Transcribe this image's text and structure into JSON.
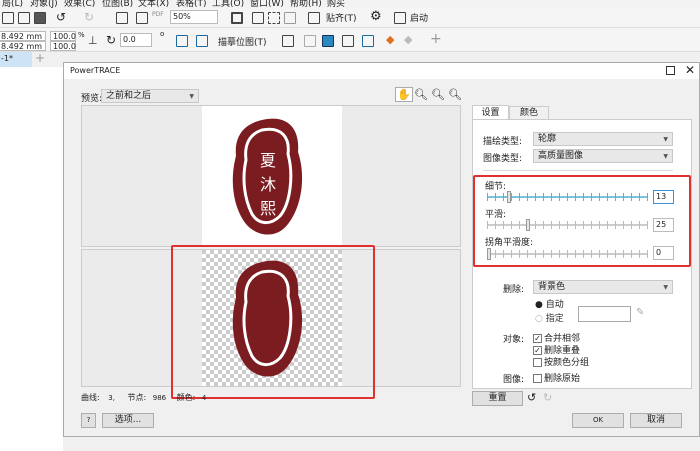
{
  "menu": [
    "局(L)",
    "对象(J)",
    "效果(C)",
    "位图(B)",
    "文本(X)",
    "表格(T)",
    "工具(O)",
    "窗口(W)",
    "帮助(H)",
    "购买"
  ],
  "toolbar": {
    "zoom": "50%",
    "snap": "贴齐(T)",
    "launch": "启动",
    "width": "8.492 mm",
    "height": "8.492 mm",
    "scale_x": "100.0",
    "scale_y": "100.0",
    "pct": "%",
    "angle": "0.0",
    "deg": "o",
    "trace_bitmap": "描摹位图(T)"
  },
  "doc_tab": "-1*",
  "dialog": {
    "title": "PowerTRACE",
    "preview_label": "预览:",
    "preview_value": "之前和之后",
    "stats": {
      "curves_label": "曲线:",
      "curves": "3,",
      "nodes_label": "节点:",
      "nodes": "986",
      "colors_label": "颜色:",
      "colors": "4"
    },
    "seal_text": [
      "夏",
      "沐",
      "熙"
    ],
    "help_btn": "?",
    "options_btn": "选项...",
    "tabs": [
      "设置",
      "颜色"
    ],
    "trace_type_label": "描绘类型:",
    "trace_type": "轮廓",
    "image_type_label": "图像类型:",
    "image_type": "高质量图像",
    "detail_label": "细节:",
    "detail_value": "13",
    "detail_pct": 0.13,
    "smooth_label": "平滑:",
    "smooth_value": "25",
    "smooth_pct": 0.25,
    "corner_label": "拐角平滑度:",
    "corner_value": "0",
    "corner_pct": 0,
    "remove_label": "删除:",
    "remove_value": "背景色",
    "auto_label": "自动",
    "specify_label": "指定",
    "object_label": "对象:",
    "merge_adjacent": "合并相邻",
    "remove_overlap": "删除重叠",
    "group_by_color": "按颜色分组",
    "image_label": "图像:",
    "remove_original": "删除原始",
    "reset_btn": "重置",
    "ok_btn": "OK",
    "cancel_btn": "取消",
    "seal_color": "#7b1c20",
    "highlight_color": "#e03030"
  }
}
